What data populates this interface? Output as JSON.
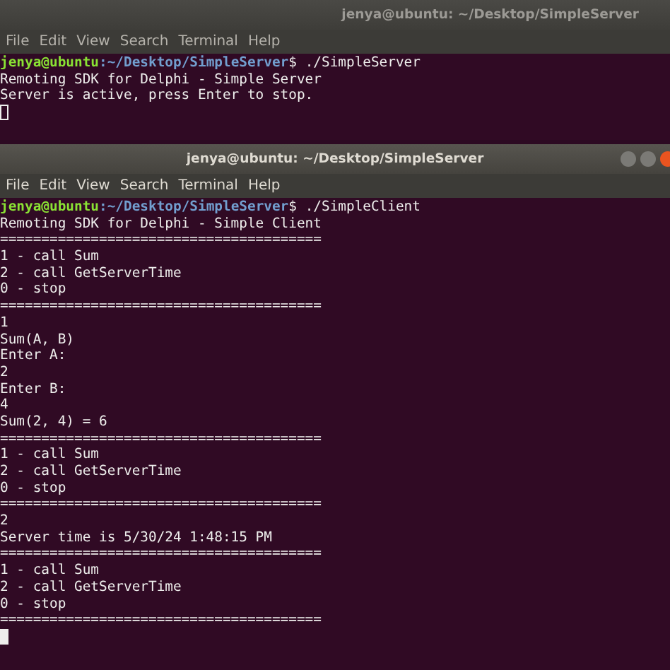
{
  "windows": [
    {
      "title": "jenya@ubuntu: ~/Desktop/SimpleServer",
      "focused": false,
      "menu": [
        "File",
        "Edit",
        "View",
        "Search",
        "Terminal",
        "Help"
      ],
      "lines": [
        {
          "kind": "prompt",
          "user": "jenya@ubuntu",
          "path": ":~/Desktop/SimpleServer",
          "command": "$ ./SimpleServer"
        },
        {
          "kind": "output",
          "text": "Remoting SDK for Delphi - Simple Server"
        },
        {
          "kind": "output",
          "text": "Server is active, press Enter to stop."
        },
        {
          "kind": "cursor"
        }
      ]
    },
    {
      "title": "jenya@ubuntu: ~/Desktop/SimpleServer",
      "focused": true,
      "menu": [
        "File",
        "Edit",
        "View",
        "Search",
        "Terminal",
        "Help"
      ],
      "lines": [
        {
          "kind": "prompt",
          "user": "jenya@ubuntu",
          "path": ":~/Desktop/SimpleServer",
          "command": "$ ./SimpleClient"
        },
        {
          "kind": "output",
          "text": "Remoting SDK for Delphi - Simple Client"
        },
        {
          "kind": "output",
          "text": "======================================="
        },
        {
          "kind": "output",
          "text": "1 - call Sum"
        },
        {
          "kind": "output",
          "text": "2 - call GetServerTime"
        },
        {
          "kind": "output",
          "text": "0 - stop"
        },
        {
          "kind": "output",
          "text": "======================================="
        },
        {
          "kind": "output",
          "text": "1"
        },
        {
          "kind": "output",
          "text": "Sum(A, B)"
        },
        {
          "kind": "output",
          "text": "Enter A:"
        },
        {
          "kind": "output",
          "text": "2"
        },
        {
          "kind": "output",
          "text": "Enter B:"
        },
        {
          "kind": "output",
          "text": "4"
        },
        {
          "kind": "output",
          "text": "Sum(2, 4) = 6"
        },
        {
          "kind": "output",
          "text": "======================================="
        },
        {
          "kind": "output",
          "text": "1 - call Sum"
        },
        {
          "kind": "output",
          "text": "2 - call GetServerTime"
        },
        {
          "kind": "output",
          "text": "0 - stop"
        },
        {
          "kind": "output",
          "text": "======================================="
        },
        {
          "kind": "output",
          "text": "2"
        },
        {
          "kind": "output",
          "text": "Server time is 5/30/24 1:48:15 PM"
        },
        {
          "kind": "output",
          "text": "======================================="
        },
        {
          "kind": "output",
          "text": "1 - call Sum"
        },
        {
          "kind": "output",
          "text": "2 - call GetServerTime"
        },
        {
          "kind": "output",
          "text": "0 - stop"
        },
        {
          "kind": "output",
          "text": "======================================="
        },
        {
          "kind": "cursor"
        }
      ]
    }
  ]
}
